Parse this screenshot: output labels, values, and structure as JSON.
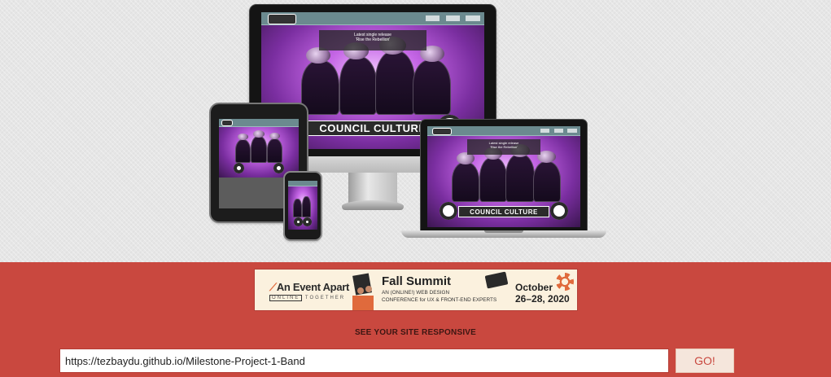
{
  "hero": {
    "panel_title": "Latest single release",
    "panel_subtitle": "'Rise the Rebellion'",
    "band_banner": "COUNCIL CULTURE"
  },
  "ad": {
    "brand": "An Event Apart",
    "tagline_box": "ONLINE",
    "tagline_rest": "TOGETHER",
    "headline": "Fall Summit",
    "description_line1": "AN (ONLINE!) WEB DESIGN",
    "description_line2": "CONFERENCE for UX & FRONT-END EXPERTS",
    "date_line1": "October",
    "date_line2": "26–28, 2020"
  },
  "form": {
    "heading": "SEE YOUR SITE RESPONSIVE",
    "url_value": "https://tezbaydu.github.io/Milestone-Project-1-Band",
    "go_label": "GO!"
  },
  "colors": {
    "bottom_bg": "#c9483f",
    "top_bg": "#e6e6e6",
    "go_text": "#c9483f",
    "ad_bg": "#fbf1de"
  }
}
